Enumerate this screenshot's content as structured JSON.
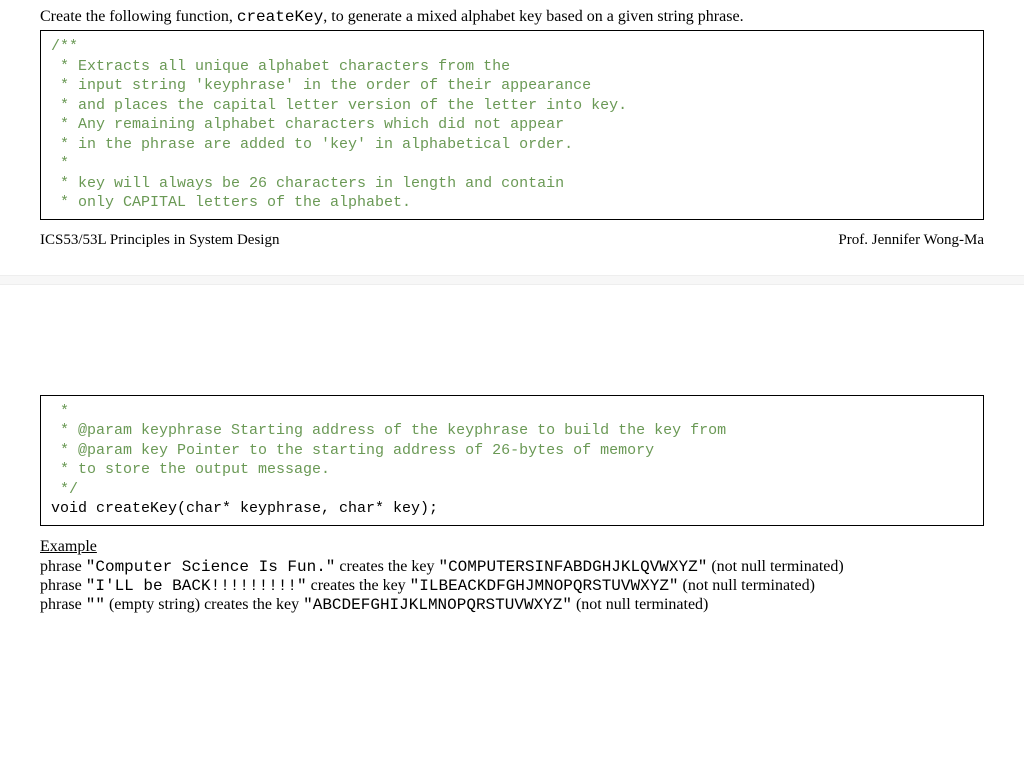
{
  "intro": {
    "prefix": "Create the following function, ",
    "funcName": "createKey",
    "suffix": ", to generate a mixed alphabet key based on a given string phrase."
  },
  "codeBox1": {
    "l1": "/**",
    "l2": " * Extracts all unique alphabet characters from the",
    "l3": " * input string 'keyphrase' in the order of their appearance",
    "l4": " * and places the capital letter version of the letter into key.",
    "l5": " * Any remaining alphabet characters which did not appear",
    "l6": " * in the phrase are added to 'key' in alphabetical order.",
    "l7": " *",
    "l8": " * key will always be 26 characters in length and contain",
    "l9": " * only CAPITAL letters of the alphabet."
  },
  "footer": {
    "left": "ICS53/53L Principles in System Design",
    "right": "Prof. Jennifer Wong-Ma"
  },
  "codeBox2": {
    "l1": " *",
    "l2": " * @param keyphrase Starting address of the keyphrase to build the key from",
    "l3": " * @param key Pointer to the starting address of 26-bytes of memory",
    "l4": " * to store the output message.",
    "l5": " */",
    "sig": "void createKey(char* keyphrase, char* key);"
  },
  "examples": {
    "heading": "Example",
    "e1": {
      "prefix": "phrase ",
      "phrase": "\"Computer Science Is Fun.\"",
      "mid": " creates the key ",
      "key": "\"COMPUTERSINFABDGHJKLQVWXYZ\"",
      "note": "  (not null terminated)"
    },
    "e2": {
      "prefix": "phrase ",
      "phrase": "\"I'LL be BACK!!!!!!!!!\"",
      "mid": " creates the key ",
      "key": "\"ILBEACKDFGHJMNOPQRSTUVWXYZ\"",
      "note": "  (not null terminated)"
    },
    "e3": {
      "prefix": "phrase ",
      "phrase": "\"\"",
      "mid1": " (empty string) creates the key ",
      "key": "\"ABCDEFGHIJKLMNOPQRSTUVWXYZ\"",
      "note": "  (not null terminated)"
    }
  }
}
